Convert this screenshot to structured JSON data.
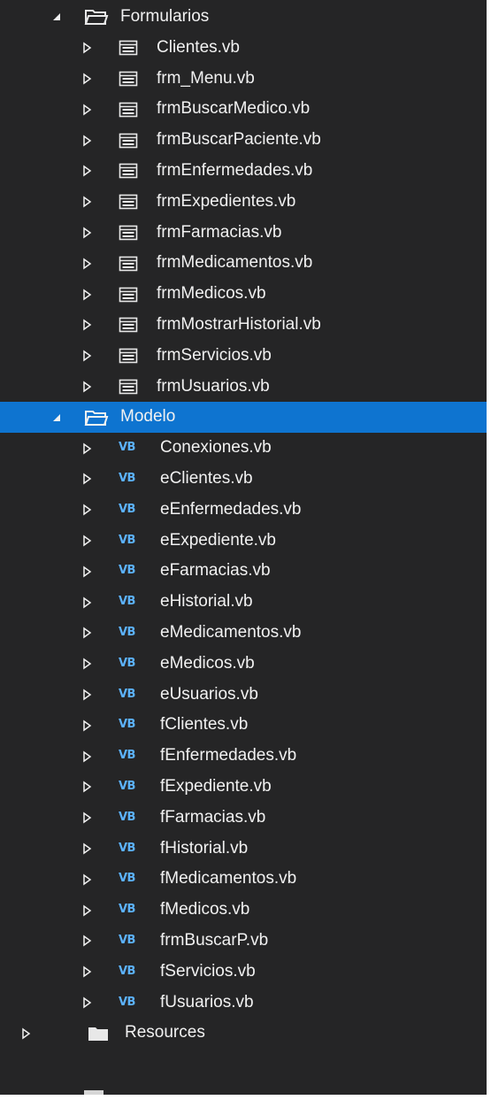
{
  "colors": {
    "panel_background": "#252526",
    "selection": "#0e74d0",
    "text": "#f1f1f1",
    "vb_badge": "#5cb3ff"
  },
  "formularios": {
    "label": "Formularios",
    "icon": "folder-open-icon",
    "expanded": true,
    "files": [
      {
        "label": "Clientes.vb",
        "icon": "form-icon"
      },
      {
        "label": "frm_Menu.vb",
        "icon": "form-icon"
      },
      {
        "label": "frmBuscarMedico.vb",
        "icon": "form-icon"
      },
      {
        "label": "frmBuscarPaciente.vb",
        "icon": "form-icon"
      },
      {
        "label": "frmEnfermedades.vb",
        "icon": "form-icon"
      },
      {
        "label": "frmExpedientes.vb",
        "icon": "form-icon"
      },
      {
        "label": "frmFarmacias.vb",
        "icon": "form-icon"
      },
      {
        "label": "frmMedicamentos.vb",
        "icon": "form-icon"
      },
      {
        "label": "frmMedicos.vb",
        "icon": "form-icon"
      },
      {
        "label": "frmMostrarHistorial.vb",
        "icon": "form-icon"
      },
      {
        "label": "frmServicios.vb",
        "icon": "form-icon"
      },
      {
        "label": "frmUsuarios.vb",
        "icon": "form-icon"
      }
    ]
  },
  "modelo": {
    "label": "Modelo",
    "icon": "folder-open-icon",
    "expanded": true,
    "selected": true,
    "badge_text": "VB",
    "files": [
      {
        "label": "Conexiones.vb",
        "icon": "vb-file-icon"
      },
      {
        "label": "eClientes.vb",
        "icon": "vb-file-icon"
      },
      {
        "label": "eEnfermedades.vb",
        "icon": "vb-file-icon"
      },
      {
        "label": "eExpediente.vb",
        "icon": "vb-file-icon"
      },
      {
        "label": "eFarmacias.vb",
        "icon": "vb-file-icon"
      },
      {
        "label": "eHistorial.vb",
        "icon": "vb-file-icon"
      },
      {
        "label": "eMedicamentos.vb",
        "icon": "vb-file-icon"
      },
      {
        "label": "eMedicos.vb",
        "icon": "vb-file-icon"
      },
      {
        "label": "eUsuarios.vb",
        "icon": "vb-file-icon"
      },
      {
        "label": "fClientes.vb",
        "icon": "vb-file-icon"
      },
      {
        "label": "fEnfermedades.vb",
        "icon": "vb-file-icon"
      },
      {
        "label": "fExpediente.vb",
        "icon": "vb-file-icon"
      },
      {
        "label": "fFarmacias.vb",
        "icon": "vb-file-icon"
      },
      {
        "label": "fHistorial.vb",
        "icon": "vb-file-icon"
      },
      {
        "label": "fMedicamentos.vb",
        "icon": "vb-file-icon"
      },
      {
        "label": "fMedicos.vb",
        "icon": "vb-file-icon"
      },
      {
        "label": "frmBuscarP.vb",
        "icon": "vb-file-icon"
      },
      {
        "label": "fServicios.vb",
        "icon": "vb-file-icon"
      },
      {
        "label": "fUsuarios.vb",
        "icon": "vb-file-icon"
      }
    ]
  },
  "resources": {
    "label": "Resources",
    "icon": "folder-closed-icon",
    "expanded": false
  }
}
